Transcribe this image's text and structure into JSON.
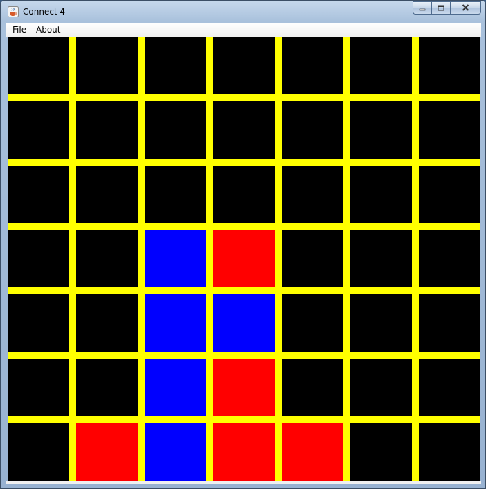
{
  "window": {
    "title": "Connect 4",
    "icon": "java-coffee-cup-icon",
    "caption_buttons": [
      "minimize-icon",
      "maximize-icon",
      "close-icon"
    ]
  },
  "menu": {
    "items": [
      "File",
      "About"
    ]
  },
  "board": {
    "columns": 7,
    "rows": 7,
    "colors": {
      "background": "#000000",
      "grid": "#ffff00",
      "red": "#ff0000",
      "blue": "#0000ff"
    },
    "cells": [
      [
        "empty",
        "empty",
        "empty",
        "empty",
        "empty",
        "empty",
        "empty"
      ],
      [
        "empty",
        "empty",
        "empty",
        "empty",
        "empty",
        "empty",
        "empty"
      ],
      [
        "empty",
        "empty",
        "empty",
        "empty",
        "empty",
        "empty",
        "empty"
      ],
      [
        "empty",
        "empty",
        "blue",
        "red",
        "empty",
        "empty",
        "empty"
      ],
      [
        "empty",
        "empty",
        "blue",
        "blue",
        "empty",
        "empty",
        "empty"
      ],
      [
        "empty",
        "empty",
        "blue",
        "red",
        "empty",
        "empty",
        "empty"
      ],
      [
        "empty",
        "red",
        "blue",
        "red",
        "red",
        "empty",
        "empty"
      ]
    ]
  }
}
